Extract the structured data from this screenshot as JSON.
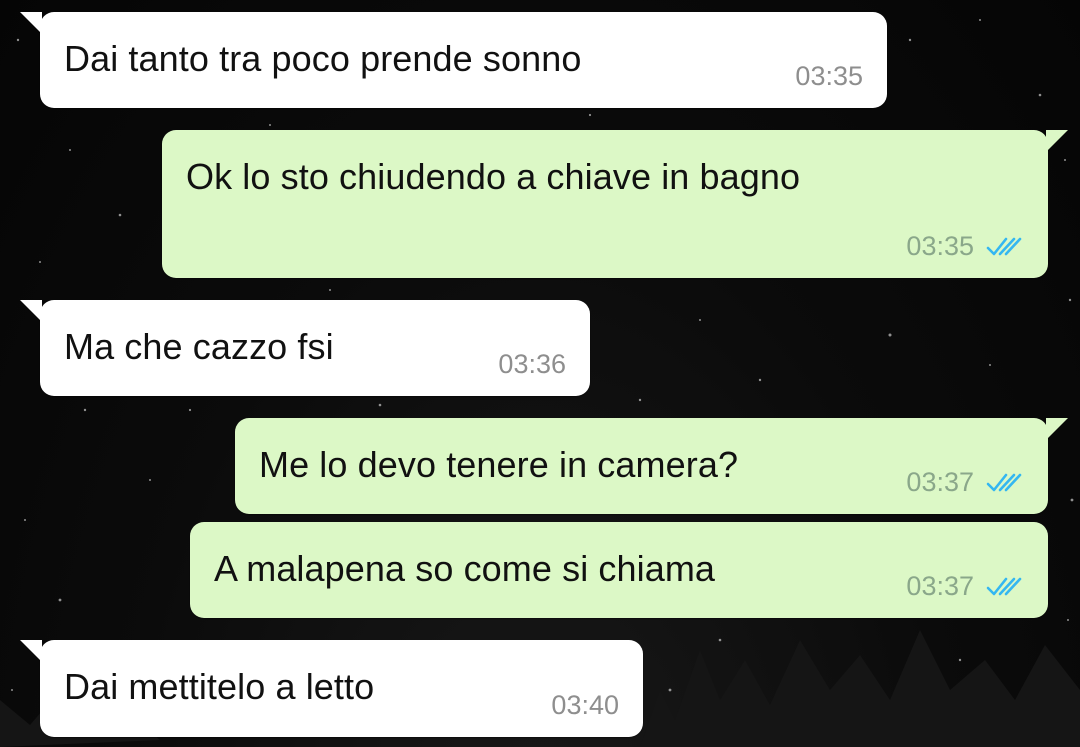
{
  "theme": {
    "incoming_bubble": "#ffffff",
    "outgoing_bubble": "#dcf8c6",
    "read_check_color": "#34b7f1",
    "wallpaper": "#0b0b0b"
  },
  "messages": [
    {
      "direction": "incoming",
      "text": "Dai tanto tra poco prende sonno",
      "time": "03:35"
    },
    {
      "direction": "outgoing",
      "text": "Ok lo sto chiudendo a chiave in bagno",
      "time": "03:35",
      "status_icon": "double-check-read-icon"
    },
    {
      "direction": "incoming",
      "text": "Ma che cazzo fsi",
      "time": "03:36"
    },
    {
      "direction": "outgoing",
      "text": "Me lo devo tenere in camera?",
      "time": "03:37",
      "status_icon": "double-check-read-icon"
    },
    {
      "direction": "outgoing",
      "text": "A malapena so come si chiama",
      "time": "03:37",
      "status_icon": "double-check-read-icon"
    },
    {
      "direction": "incoming",
      "text": "Dai mettitelo a letto",
      "time": "03:40"
    }
  ]
}
